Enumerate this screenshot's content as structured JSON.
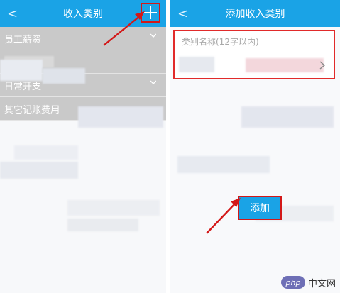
{
  "left": {
    "back_icon": "<",
    "title": "收入类别",
    "add_icon": "plus-icon",
    "items": [
      {
        "label": "员工薪资"
      },
      {
        "label": ""
      },
      {
        "label": "日常开支"
      },
      {
        "label": "其它记账费用"
      }
    ]
  },
  "right": {
    "back_icon": "<",
    "title": "添加收入类别",
    "name_placeholder": "类别名称(12字以内)",
    "add_button": "添加"
  },
  "watermark": {
    "badge": "php",
    "text": "中文网"
  },
  "colors": {
    "header": "#1aa3e6",
    "highlight": "#d31818",
    "list_bg": "#c9c9c9"
  }
}
